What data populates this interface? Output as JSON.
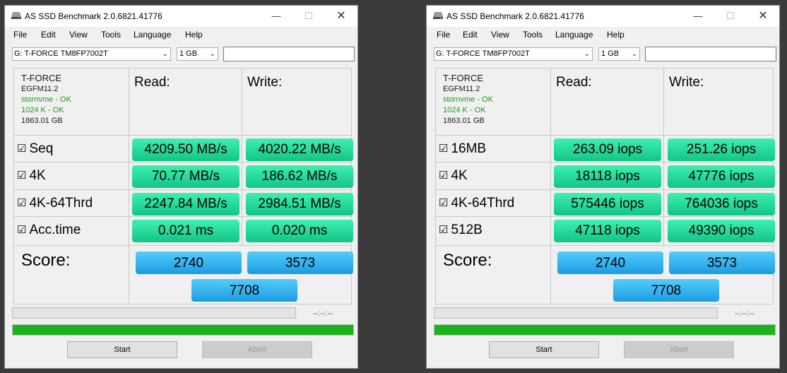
{
  "colors": {
    "result_green": "#1fd89a",
    "score_blue": "#2eb0ee",
    "progress_green": "#1db31d",
    "ok_text": "#1e9c1e"
  },
  "windows": [
    {
      "title": "AS SSD Benchmark 2.0.6821.41776",
      "controls": {
        "minimize": "—",
        "maximize": "☐",
        "close": "✕"
      },
      "menu": [
        "File",
        "Edit",
        "View",
        "Tools",
        "Language",
        "Help"
      ],
      "drive_select": "G: T-FORCE TM8FP7002T",
      "size_select": "1 GB",
      "text_field": "",
      "drive_info": {
        "name": "T-FORCE",
        "firmware": "EGFM11.2",
        "driver": "stornvme - OK",
        "alignment": "1024 K - OK",
        "capacity": "1863.01 GB"
      },
      "headers": {
        "read": "Read:",
        "write": "Write:"
      },
      "rows": [
        {
          "label": "Seq",
          "read": "4209.50 MB/s",
          "write": "4020.22 MB/s"
        },
        {
          "label": "4K",
          "read": "70.77 MB/s",
          "write": "186.62 MB/s"
        },
        {
          "label": "4K-64Thrd",
          "read": "2247.84 MB/s",
          "write": "2984.51 MB/s"
        },
        {
          "label": "Acc.time",
          "read": "0.021 ms",
          "write": "0.020 ms"
        }
      ],
      "score": {
        "label": "Score:",
        "read": "2740",
        "write": "3573",
        "total": "7708"
      },
      "timer": "--:--:--",
      "progress": 1.0,
      "buttons": {
        "start": "Start",
        "abort": "Abort"
      }
    },
    {
      "title": "AS SSD Benchmark 2.0.6821.41776",
      "controls": {
        "minimize": "—",
        "maximize": "☐",
        "close": "✕"
      },
      "menu": [
        "File",
        "Edit",
        "View",
        "Tools",
        "Language",
        "Help"
      ],
      "drive_select": "G: T-FORCE TM8FP7002T",
      "size_select": "1 GB",
      "text_field": "",
      "drive_info": {
        "name": "T-FORCE",
        "firmware": "EGFM11.2",
        "driver": "stornvme - OK",
        "alignment": "1024 K - OK",
        "capacity": "1863.01 GB"
      },
      "headers": {
        "read": "Read:",
        "write": "Write:"
      },
      "rows": [
        {
          "label": "16MB",
          "read": "263.09 iops",
          "write": "251.26 iops"
        },
        {
          "label": "4K",
          "read": "18118 iops",
          "write": "47776 iops"
        },
        {
          "label": "4K-64Thrd",
          "read": "575446 iops",
          "write": "764036 iops"
        },
        {
          "label": "512B",
          "read": "47118 iops",
          "write": "49390 iops"
        }
      ],
      "score": {
        "label": "Score:",
        "read": "2740",
        "write": "3573",
        "total": "7708"
      },
      "timer": "--:--:--",
      "progress": 1.0,
      "buttons": {
        "start": "Start",
        "abort": "Abort"
      }
    }
  ]
}
